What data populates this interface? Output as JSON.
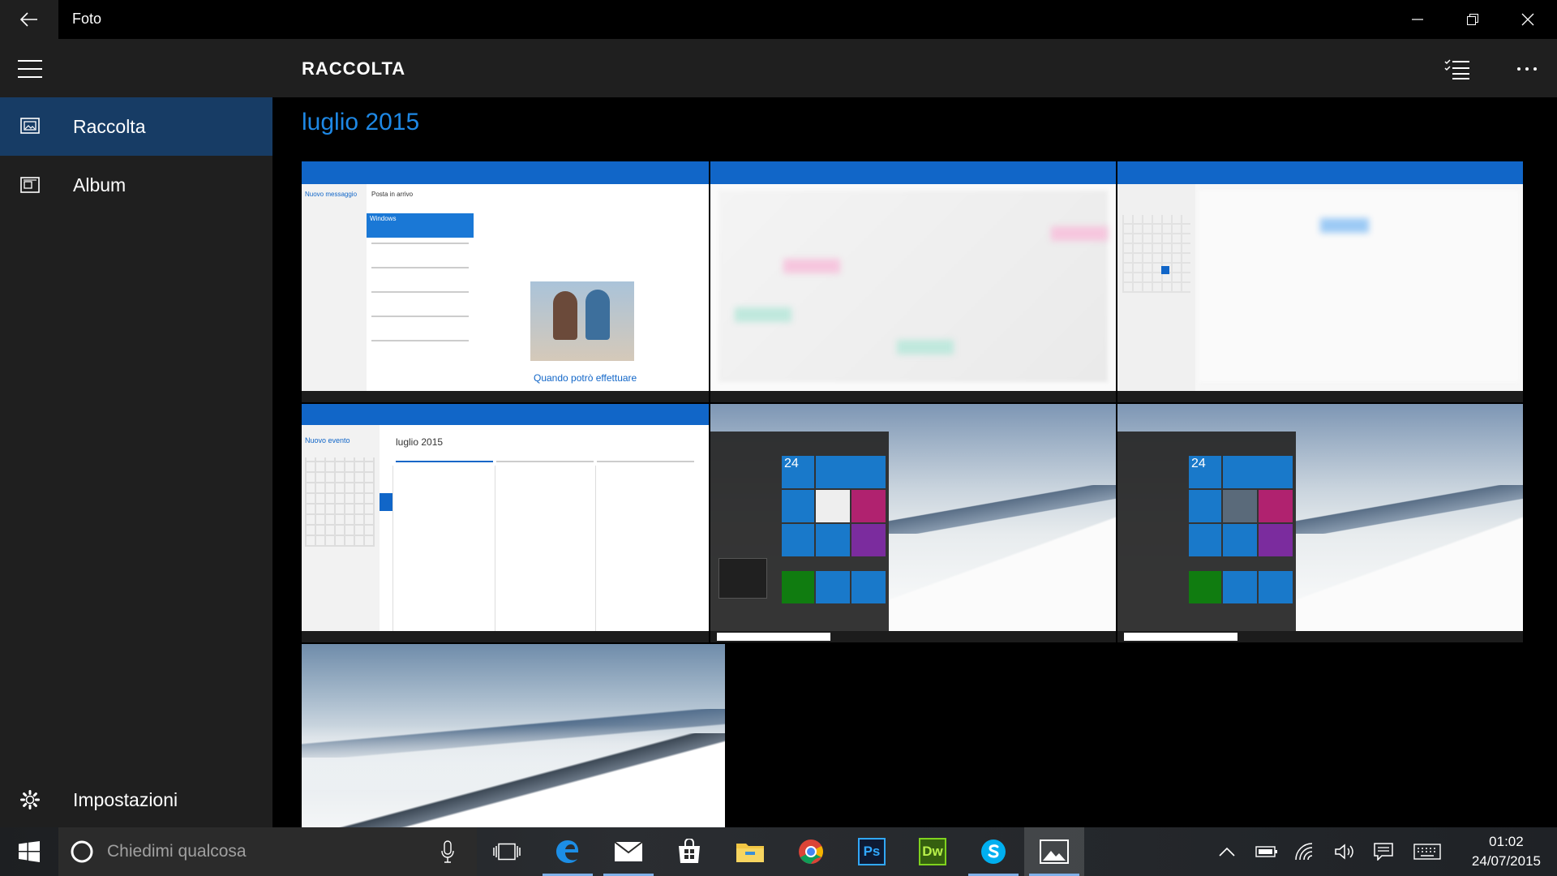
{
  "window": {
    "title": "Foto"
  },
  "sidebar": {
    "items": [
      {
        "label": "Raccolta",
        "icon": "gallery-icon",
        "active": true
      },
      {
        "label": "Album",
        "icon": "album-icon",
        "active": false
      }
    ],
    "settings_label": "Impostazioni"
  },
  "header": {
    "title": "RACCOLTA"
  },
  "content": {
    "group_label": "luglio 2015",
    "photos": [
      {
        "kind": "mail-screenshot",
        "texts": {
          "new_message": "Nuovo messaggio",
          "inbox": "Posta in arrivo",
          "sender": "Windows",
          "footer": "Quando potrò effettuare"
        }
      },
      {
        "kind": "calendar-blurred"
      },
      {
        "kind": "calendar-blurred-small"
      },
      {
        "kind": "calendar-screenshot",
        "texts": {
          "new_event": "Nuovo evento",
          "month": "luglio 2015"
        }
      },
      {
        "kind": "start-menu-screenshot",
        "texts": {
          "date": "24"
        }
      },
      {
        "kind": "start-menu-screenshot",
        "texts": {
          "date": "24"
        }
      },
      {
        "kind": "mountain-wallpaper"
      }
    ]
  },
  "taskbar": {
    "search_placeholder": "Chiedimi qualcosa",
    "apps": [
      "task-view-icon",
      "edge-icon",
      "mail-icon",
      "store-icon",
      "file-explorer-icon",
      "chrome-icon",
      "photoshop-icon",
      "dreamweaver-icon",
      "skype-icon",
      "photos-icon"
    ],
    "photoshop_label": "Ps",
    "dreamweaver_label": "Dw",
    "time": "01:02",
    "date": "24/07/2015"
  },
  "colors": {
    "accent": "#1e88e5",
    "sidebar_active": "#173c65",
    "sidebar_bg": "#1f1f1f"
  }
}
